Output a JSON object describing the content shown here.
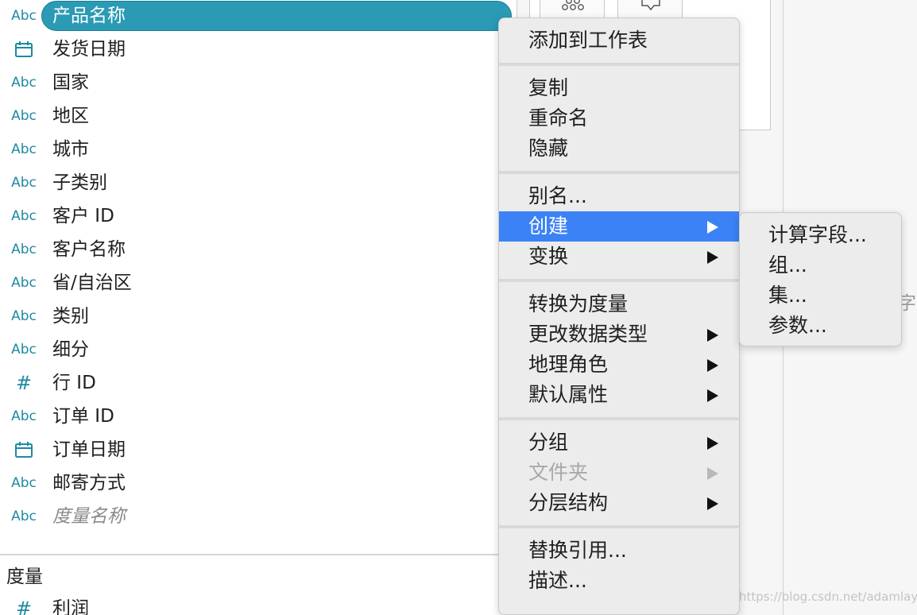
{
  "fields": [
    {
      "type": "Abc",
      "type_icon": "abc-string-icon",
      "name": "产品名称",
      "selected": true
    },
    {
      "type": "",
      "type_icon": "calendar-date-icon",
      "name": "发货日期"
    },
    {
      "type": "Abc",
      "type_icon": "abc-string-icon",
      "name": "国家"
    },
    {
      "type": "Abc",
      "type_icon": "abc-string-icon",
      "name": "地区"
    },
    {
      "type": "Abc",
      "type_icon": "abc-string-icon",
      "name": "城市"
    },
    {
      "type": "Abc",
      "type_icon": "abc-string-icon",
      "name": "子类别"
    },
    {
      "type": "Abc",
      "type_icon": "abc-string-icon",
      "name": "客户 ID"
    },
    {
      "type": "Abc",
      "type_icon": "abc-string-icon",
      "name": "客户名称"
    },
    {
      "type": "Abc",
      "type_icon": "abc-string-icon",
      "name": "省/自治区"
    },
    {
      "type": "Abc",
      "type_icon": "abc-string-icon",
      "name": "类别"
    },
    {
      "type": "Abc",
      "type_icon": "abc-string-icon",
      "name": "细分"
    },
    {
      "type": "#",
      "type_icon": "number-hash-icon",
      "name": "行 ID"
    },
    {
      "type": "Abc",
      "type_icon": "abc-string-icon",
      "name": "订单 ID"
    },
    {
      "type": "",
      "type_icon": "calendar-date-icon",
      "name": "订单日期"
    },
    {
      "type": "Abc",
      "type_icon": "abc-string-icon",
      "name": "邮寄方式"
    },
    {
      "type": "Abc",
      "type_icon": "abc-string-icon",
      "name": "度量名称",
      "italic": true
    }
  ],
  "measures": {
    "title": "度量",
    "items": [
      {
        "type": "#",
        "type_icon": "number-hash-icon",
        "name": "利润"
      }
    ]
  },
  "context_menu": {
    "groups": [
      [
        {
          "label": "添加到工作表"
        }
      ],
      [
        {
          "label": "复制"
        },
        {
          "label": "重命名"
        },
        {
          "label": "隐藏"
        }
      ],
      [
        {
          "label": "别名..."
        },
        {
          "label": "创建",
          "submenu": true,
          "highlighted": true
        },
        {
          "label": "变换",
          "submenu": true
        }
      ],
      [
        {
          "label": "转换为度量"
        },
        {
          "label": "更改数据类型",
          "submenu": true
        },
        {
          "label": "地理角色",
          "submenu": true
        },
        {
          "label": "默认属性",
          "submenu": true
        }
      ],
      [
        {
          "label": "分组",
          "submenu": true
        },
        {
          "label": "文件夹",
          "submenu": true,
          "disabled": true
        },
        {
          "label": "分层结构",
          "submenu": true
        }
      ],
      [
        {
          "label": "替换引用..."
        },
        {
          "label": "描述..."
        }
      ]
    ]
  },
  "submenu": {
    "items": [
      {
        "label": "计算字段..."
      },
      {
        "label": "组..."
      },
      {
        "label": "集..."
      },
      {
        "label": "参数..."
      }
    ]
  },
  "background": {
    "clipped_text": "字",
    "watermark": "https://blog.csdn.net/adamlay"
  },
  "colors": {
    "selection_pill": "#2b9ab5",
    "menu_highlight": "#3b82f6",
    "type_icon": "#1e8aa1"
  }
}
